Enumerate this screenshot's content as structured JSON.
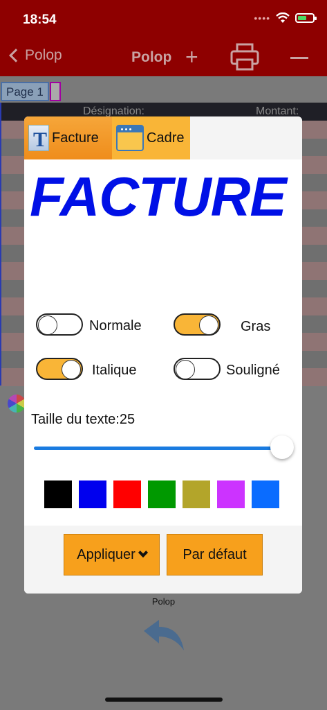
{
  "status": {
    "time": "18:54"
  },
  "nav": {
    "back_label": "Polop",
    "title": "Polop",
    "plus": "+"
  },
  "background": {
    "page_tab": "Page 1",
    "col_designation": "Désignation:",
    "col_montant": "Montant:",
    "footer_label": "Polop"
  },
  "dialog": {
    "tabs": [
      {
        "label": "Facture",
        "icon": "text-style-icon"
      },
      {
        "label": "Cadre",
        "icon": "window-frame-icon"
      }
    ],
    "preview_text": "FACTURE",
    "toggles": {
      "normale": {
        "label": "Normale",
        "on": false
      },
      "gras": {
        "label": "Gras",
        "on": true
      },
      "italique": {
        "label": "Italique",
        "on": true
      },
      "souligne": {
        "label": "Souligné",
        "on": false
      }
    },
    "size_label": "Taille du texte:25",
    "slider_value": 25,
    "colors": [
      "#000000",
      "#0000ee",
      "#ff0000",
      "#009900",
      "#b3a52a",
      "#cc33ff",
      "#0a6cff"
    ],
    "apply_label": "Appliquer",
    "default_label": "Par défaut"
  }
}
